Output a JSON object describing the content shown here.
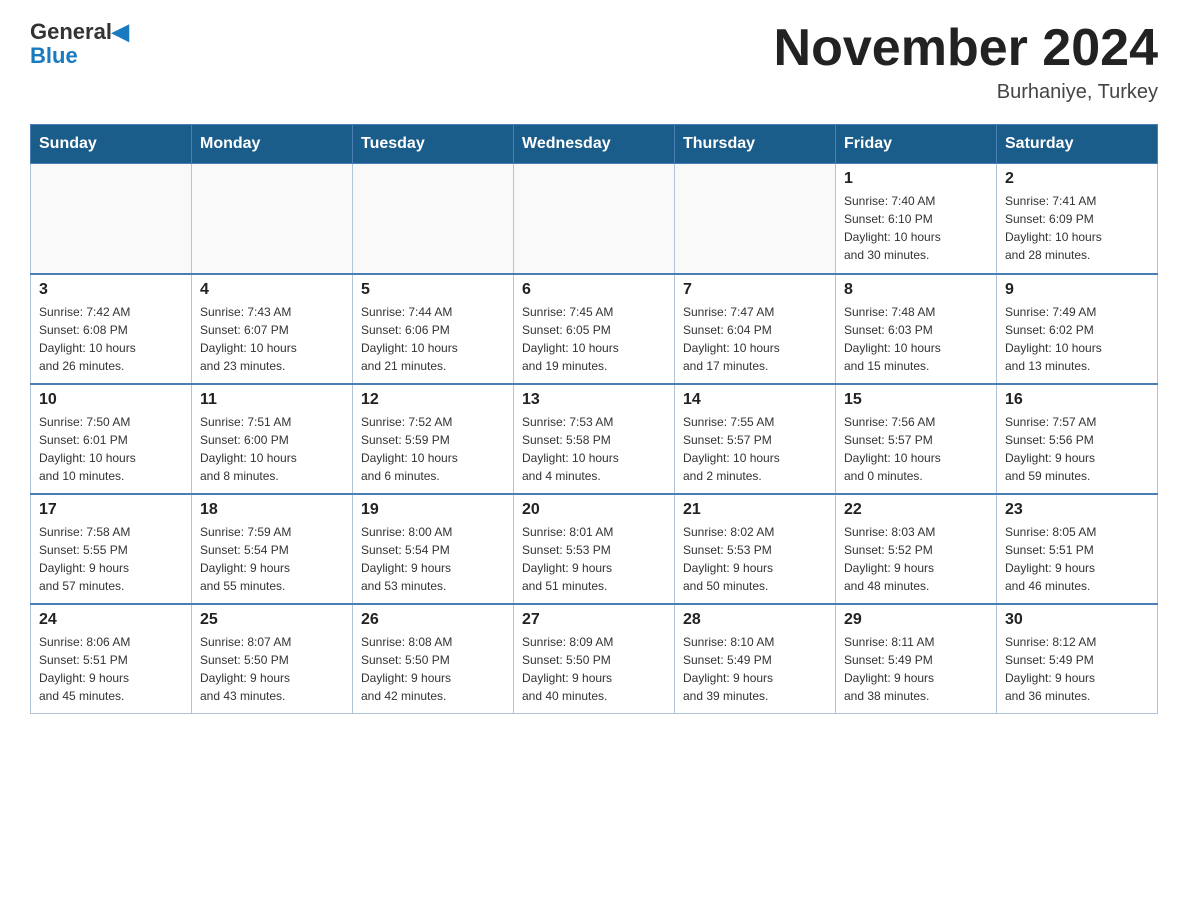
{
  "header": {
    "logo_line1": "General",
    "logo_line2": "Blue",
    "month_title": "November 2024",
    "location": "Burhaniye, Turkey"
  },
  "days_of_week": [
    "Sunday",
    "Monday",
    "Tuesday",
    "Wednesday",
    "Thursday",
    "Friday",
    "Saturday"
  ],
  "weeks": [
    [
      {
        "day": "",
        "info": ""
      },
      {
        "day": "",
        "info": ""
      },
      {
        "day": "",
        "info": ""
      },
      {
        "day": "",
        "info": ""
      },
      {
        "day": "",
        "info": ""
      },
      {
        "day": "1",
        "info": "Sunrise: 7:40 AM\nSunset: 6:10 PM\nDaylight: 10 hours\nand 30 minutes."
      },
      {
        "day": "2",
        "info": "Sunrise: 7:41 AM\nSunset: 6:09 PM\nDaylight: 10 hours\nand 28 minutes."
      }
    ],
    [
      {
        "day": "3",
        "info": "Sunrise: 7:42 AM\nSunset: 6:08 PM\nDaylight: 10 hours\nand 26 minutes."
      },
      {
        "day": "4",
        "info": "Sunrise: 7:43 AM\nSunset: 6:07 PM\nDaylight: 10 hours\nand 23 minutes."
      },
      {
        "day": "5",
        "info": "Sunrise: 7:44 AM\nSunset: 6:06 PM\nDaylight: 10 hours\nand 21 minutes."
      },
      {
        "day": "6",
        "info": "Sunrise: 7:45 AM\nSunset: 6:05 PM\nDaylight: 10 hours\nand 19 minutes."
      },
      {
        "day": "7",
        "info": "Sunrise: 7:47 AM\nSunset: 6:04 PM\nDaylight: 10 hours\nand 17 minutes."
      },
      {
        "day": "8",
        "info": "Sunrise: 7:48 AM\nSunset: 6:03 PM\nDaylight: 10 hours\nand 15 minutes."
      },
      {
        "day": "9",
        "info": "Sunrise: 7:49 AM\nSunset: 6:02 PM\nDaylight: 10 hours\nand 13 minutes."
      }
    ],
    [
      {
        "day": "10",
        "info": "Sunrise: 7:50 AM\nSunset: 6:01 PM\nDaylight: 10 hours\nand 10 minutes."
      },
      {
        "day": "11",
        "info": "Sunrise: 7:51 AM\nSunset: 6:00 PM\nDaylight: 10 hours\nand 8 minutes."
      },
      {
        "day": "12",
        "info": "Sunrise: 7:52 AM\nSunset: 5:59 PM\nDaylight: 10 hours\nand 6 minutes."
      },
      {
        "day": "13",
        "info": "Sunrise: 7:53 AM\nSunset: 5:58 PM\nDaylight: 10 hours\nand 4 minutes."
      },
      {
        "day": "14",
        "info": "Sunrise: 7:55 AM\nSunset: 5:57 PM\nDaylight: 10 hours\nand 2 minutes."
      },
      {
        "day": "15",
        "info": "Sunrise: 7:56 AM\nSunset: 5:57 PM\nDaylight: 10 hours\nand 0 minutes."
      },
      {
        "day": "16",
        "info": "Sunrise: 7:57 AM\nSunset: 5:56 PM\nDaylight: 9 hours\nand 59 minutes."
      }
    ],
    [
      {
        "day": "17",
        "info": "Sunrise: 7:58 AM\nSunset: 5:55 PM\nDaylight: 9 hours\nand 57 minutes."
      },
      {
        "day": "18",
        "info": "Sunrise: 7:59 AM\nSunset: 5:54 PM\nDaylight: 9 hours\nand 55 minutes."
      },
      {
        "day": "19",
        "info": "Sunrise: 8:00 AM\nSunset: 5:54 PM\nDaylight: 9 hours\nand 53 minutes."
      },
      {
        "day": "20",
        "info": "Sunrise: 8:01 AM\nSunset: 5:53 PM\nDaylight: 9 hours\nand 51 minutes."
      },
      {
        "day": "21",
        "info": "Sunrise: 8:02 AM\nSunset: 5:53 PM\nDaylight: 9 hours\nand 50 minutes."
      },
      {
        "day": "22",
        "info": "Sunrise: 8:03 AM\nSunset: 5:52 PM\nDaylight: 9 hours\nand 48 minutes."
      },
      {
        "day": "23",
        "info": "Sunrise: 8:05 AM\nSunset: 5:51 PM\nDaylight: 9 hours\nand 46 minutes."
      }
    ],
    [
      {
        "day": "24",
        "info": "Sunrise: 8:06 AM\nSunset: 5:51 PM\nDaylight: 9 hours\nand 45 minutes."
      },
      {
        "day": "25",
        "info": "Sunrise: 8:07 AM\nSunset: 5:50 PM\nDaylight: 9 hours\nand 43 minutes."
      },
      {
        "day": "26",
        "info": "Sunrise: 8:08 AM\nSunset: 5:50 PM\nDaylight: 9 hours\nand 42 minutes."
      },
      {
        "day": "27",
        "info": "Sunrise: 8:09 AM\nSunset: 5:50 PM\nDaylight: 9 hours\nand 40 minutes."
      },
      {
        "day": "28",
        "info": "Sunrise: 8:10 AM\nSunset: 5:49 PM\nDaylight: 9 hours\nand 39 minutes."
      },
      {
        "day": "29",
        "info": "Sunrise: 8:11 AM\nSunset: 5:49 PM\nDaylight: 9 hours\nand 38 minutes."
      },
      {
        "day": "30",
        "info": "Sunrise: 8:12 AM\nSunset: 5:49 PM\nDaylight: 9 hours\nand 36 minutes."
      }
    ]
  ]
}
